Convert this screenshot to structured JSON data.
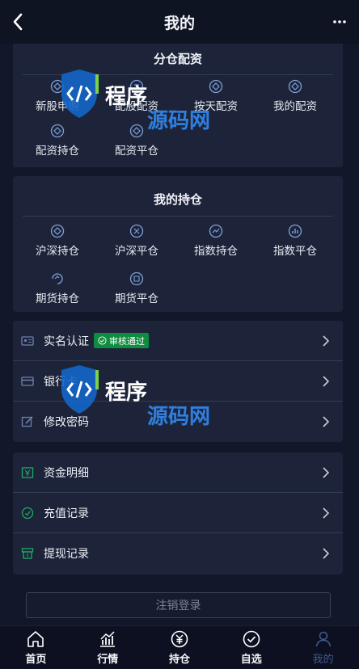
{
  "header": {
    "title": "我的"
  },
  "sections": {
    "allocation": {
      "title": "分仓配资",
      "items": [
        {
          "label": "新股申购",
          "icon": "ipo-icon"
        },
        {
          "label": "配股配资",
          "icon": "rights-icon"
        },
        {
          "label": "按天配资",
          "icon": "daily-icon"
        },
        {
          "label": "我的配资",
          "icon": "my-allocation-icon"
        },
        {
          "label": "配资持仓",
          "icon": "allocation-position-icon"
        },
        {
          "label": "配资平仓",
          "icon": "allocation-close-icon"
        }
      ]
    },
    "positions": {
      "title": "我的持仓",
      "items": [
        {
          "label": "沪深持仓",
          "icon": "sh-sz-position-icon"
        },
        {
          "label": "沪深平仓",
          "icon": "sh-sz-close-icon"
        },
        {
          "label": "指数持仓",
          "icon": "index-position-icon"
        },
        {
          "label": "指数平仓",
          "icon": "index-close-icon"
        },
        {
          "label": "期货持仓",
          "icon": "futures-position-icon"
        },
        {
          "label": "期货平仓",
          "icon": "futures-close-icon"
        }
      ]
    }
  },
  "account": {
    "realname": {
      "label": "实名认证",
      "badge": "审核通过"
    },
    "bankcard": {
      "label": "银行卡"
    },
    "password": {
      "label": "修改密码"
    }
  },
  "funds": {
    "details": {
      "label": "资金明细"
    },
    "recharge": {
      "label": "充值记录"
    },
    "withdraw": {
      "label": "提现记录"
    }
  },
  "logout": {
    "label": "注销登录"
  },
  "tabbar": {
    "tabs": [
      {
        "label": "首页"
      },
      {
        "label": "行情"
      },
      {
        "label": "持仓"
      },
      {
        "label": "自选"
      },
      {
        "label": "我的"
      }
    ]
  },
  "watermark": {
    "text1": "程序",
    "text2": "源码网"
  },
  "colors": {
    "background": "#12182a",
    "card": "#1d2439",
    "badge": "#0e8c3f",
    "active_tab": "#3f5a8f"
  }
}
